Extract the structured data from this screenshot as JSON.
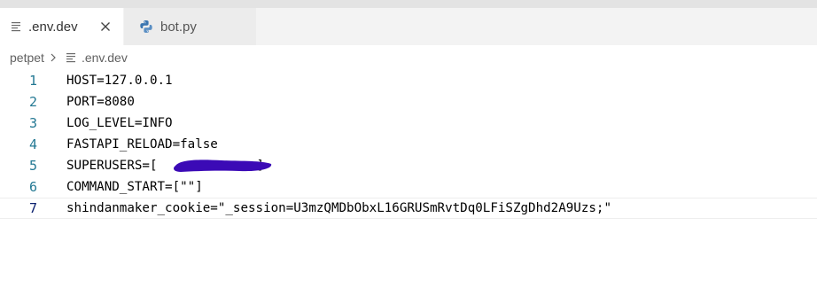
{
  "tabs": [
    {
      "label": ".env.dev",
      "icon": "lines-file-icon",
      "active": true,
      "close_icon": "close-icon"
    },
    {
      "label": "bot.py",
      "icon": "python-icon",
      "active": false
    }
  ],
  "breadcrumb": {
    "folder": "petpet",
    "separator_icon": "chevron-right-icon",
    "file_icon": "lines-file-icon",
    "file": ".env.dev"
  },
  "editor": {
    "lines": [
      {
        "number": "1",
        "text": "HOST=127.0.0.1"
      },
      {
        "number": "2",
        "text": "PORT=8080"
      },
      {
        "number": "3",
        "text": "LOG_LEVEL=INFO"
      },
      {
        "number": "4",
        "text": "FASTAPI_RELOAD=false"
      },
      {
        "number": "5",
        "text": "SUPERUSERS=[",
        "after_redaction": "]",
        "redaction_color": "#3b0ab6"
      },
      {
        "number": "6",
        "text": "COMMAND_START=[\"\"]"
      },
      {
        "number": "7",
        "text": "shindanmaker_cookie=\"_session=U3mzQMDbObxL16GRUSmRvtDq0LFiSZgDhd2A9Uzs;\""
      }
    ],
    "colors": {
      "line_number": "#237893",
      "active_line_number": "#0b216f",
      "text": "#000000"
    }
  }
}
